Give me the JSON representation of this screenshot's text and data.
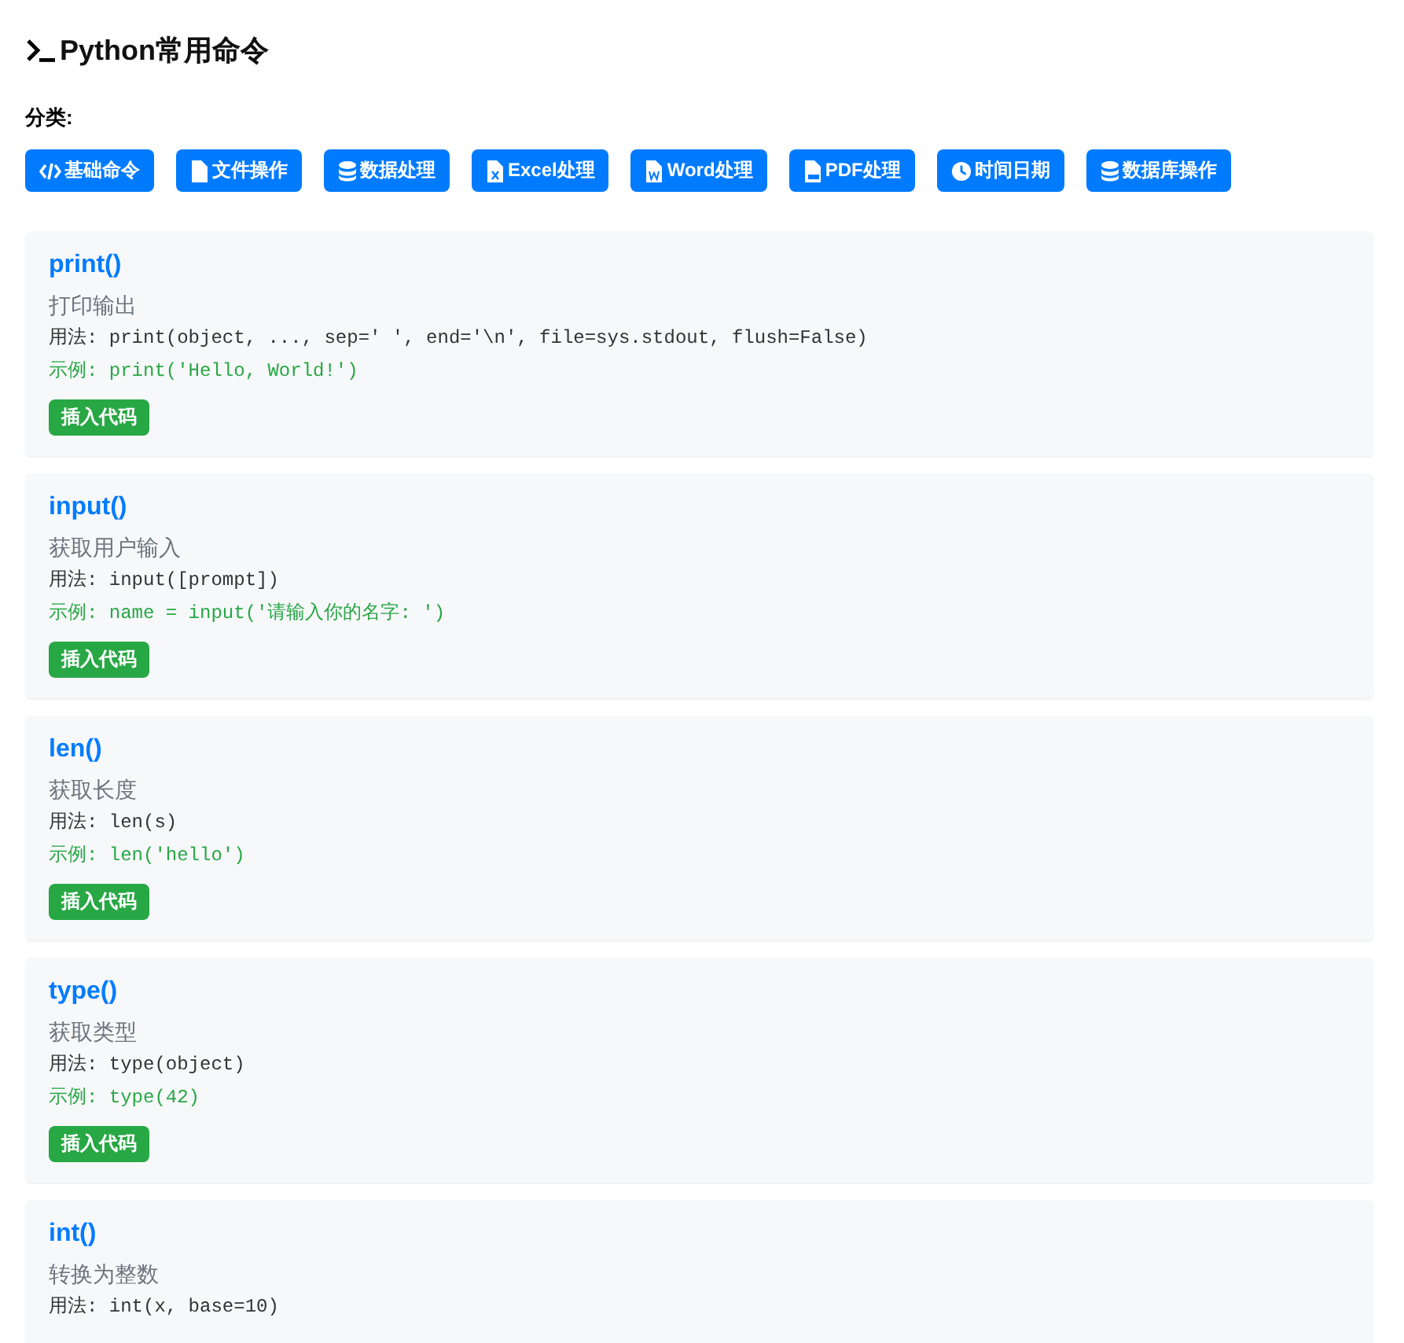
{
  "title": "Python常用命令",
  "category_label": "分类:",
  "categories": [
    {
      "label": "基础命令",
      "kind": "code"
    },
    {
      "label": "文件操作",
      "kind": "file"
    },
    {
      "label": "数据处理",
      "kind": "database"
    },
    {
      "label": "Excel处理",
      "kind": "excel"
    },
    {
      "label": "Word处理",
      "kind": "word"
    },
    {
      "label": "PDF处理",
      "kind": "pdf"
    },
    {
      "label": "时间日期",
      "kind": "clock"
    },
    {
      "label": "数据库操作",
      "kind": "database"
    }
  ],
  "commands": [
    {
      "name": "print()",
      "description": "打印输出",
      "usage": "用法: print(object, ..., sep=' ', end='\\n', file=sys.stdout, flush=False)",
      "example": "示例: print('Hello, World!')",
      "button": "插入代码"
    },
    {
      "name": "input()",
      "description": "获取用户输入",
      "usage": "用法: input([prompt])",
      "example": "示例: name = input('请输入你的名字: ')",
      "button": "插入代码"
    },
    {
      "name": "len()",
      "description": "获取长度",
      "usage": "用法: len(s)",
      "example": "示例: len('hello')",
      "button": "插入代码"
    },
    {
      "name": "type()",
      "description": "获取类型",
      "usage": "用法: type(object)",
      "example": "示例: type(42)",
      "button": "插入代码"
    },
    {
      "name": "int()",
      "description": "转换为整数",
      "usage": "用法: int(x, base=10)"
    }
  ]
}
